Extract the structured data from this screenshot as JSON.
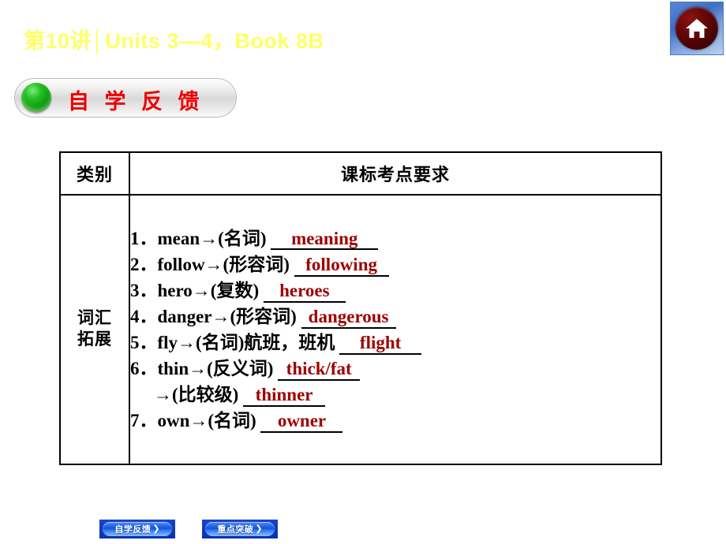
{
  "header": {
    "title": "第10讲│Units 3—4，Book 8B",
    "title_color": "#ffff66",
    "home_icon": "home-icon"
  },
  "banner": {
    "label": "自 学 反 馈",
    "label_color": "#ee0000",
    "bullet_color": "#089808"
  },
  "table": {
    "headers": {
      "category": "类别",
      "requirement": "课标考点要求"
    },
    "category_label_line1": "词汇",
    "category_label_line2": "拓展",
    "answer_color": "#9e0000",
    "entries": [
      {
        "num": "1．",
        "stem": "mean→(名词)",
        "answer": "meaning",
        "tail": ""
      },
      {
        "num": "2．",
        "stem": "follow→(形容词)",
        "answer": "following",
        "tail": ""
      },
      {
        "num": "3．",
        "stem": "hero→(复数)",
        "answer": "heroes",
        "tail": ""
      },
      {
        "num": "4．",
        "stem": "danger→(形容词)",
        "answer": "dangerous",
        "tail": ""
      },
      {
        "num": "5．",
        "stem": "fly→(名词)航班，班机",
        "answer": "flight",
        "tail": ""
      },
      {
        "num": "6．",
        "stem": "thin→(反义词)",
        "answer": "thick/fat",
        "tail": ""
      },
      {
        "num": "",
        "stem": "→(比较级)",
        "answer": "thinner",
        "tail": ""
      },
      {
        "num": "7．",
        "stem": "own→(名词)",
        "answer": "owner",
        "tail": ""
      }
    ]
  },
  "footer": {
    "buttons": [
      {
        "label": "自学反馈",
        "chevron": "❯"
      },
      {
        "label": "重点突破",
        "chevron": "❯"
      }
    ]
  }
}
